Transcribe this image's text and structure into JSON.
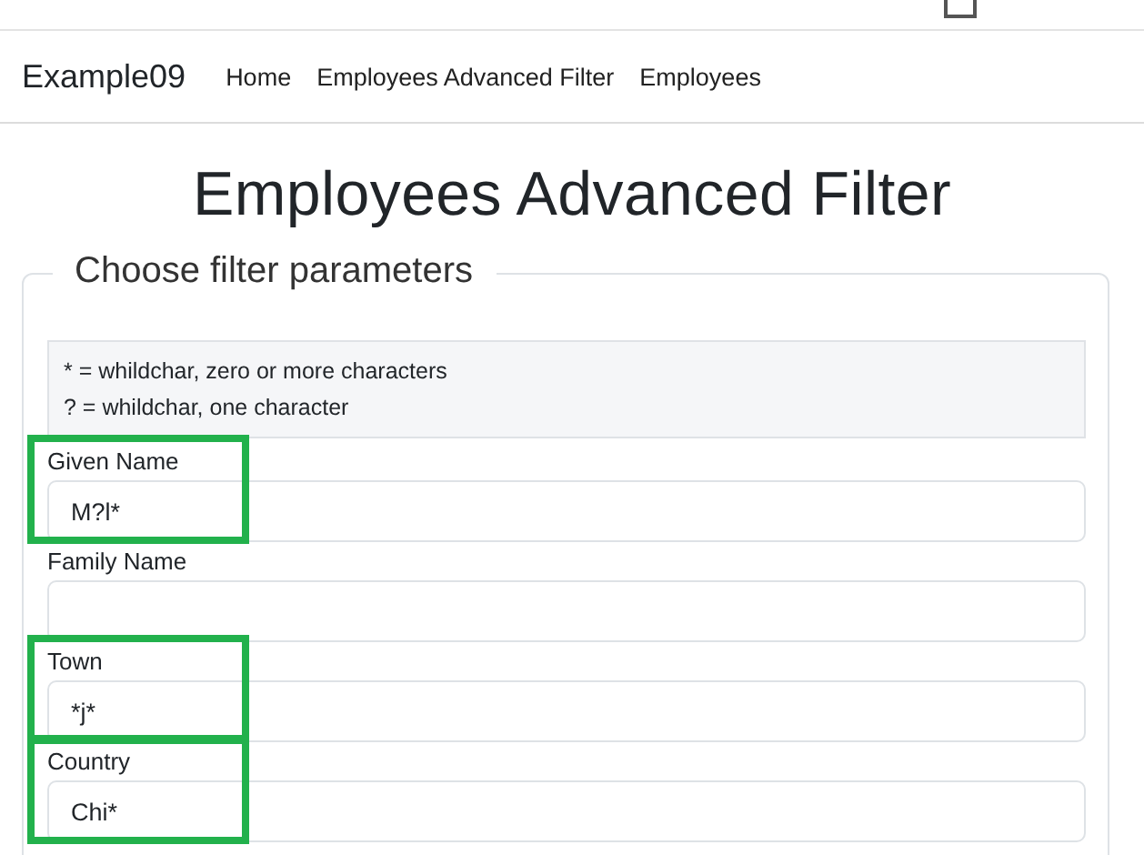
{
  "navbar": {
    "brand": "Example09",
    "links": [
      {
        "label": "Home"
      },
      {
        "label": "Employees Advanced Filter"
      },
      {
        "label": "Employees"
      }
    ]
  },
  "heading": "Employees Advanced Filter",
  "filter": {
    "legend": "Choose filter parameters",
    "hints": [
      "* = whildchar, zero or more characters",
      "? = whildchar, one character"
    ],
    "fields": [
      {
        "label": "Given Name",
        "value": "M?l*",
        "highlighted": true
      },
      {
        "label": "Family Name",
        "highlighted": false
      },
      {
        "label": "Town",
        "value": "*j*",
        "highlighted": true
      },
      {
        "label": "Country",
        "value": "Chi*",
        "highlighted": true
      }
    ]
  }
}
